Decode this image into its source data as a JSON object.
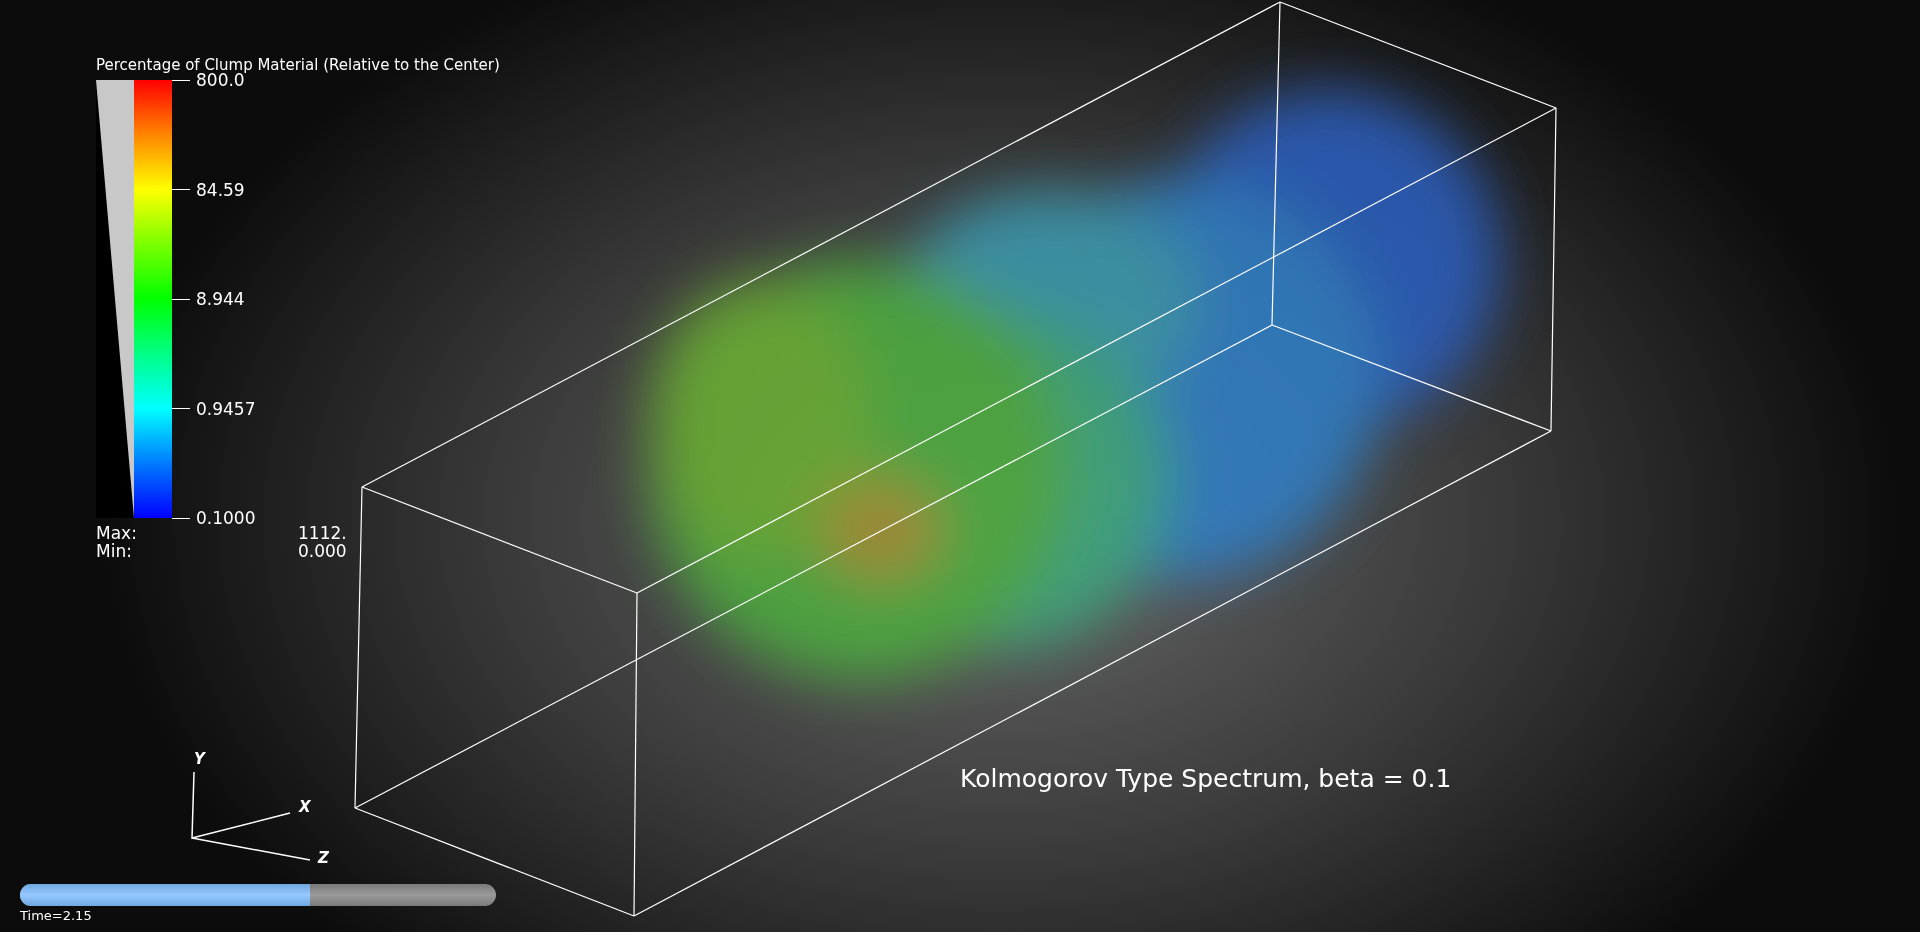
{
  "legend": {
    "title": "Percentage of Clump Material (Relative to the Center)",
    "ticks": [
      "800.0",
      "84.59",
      "8.944",
      "0.9457",
      "0.1000"
    ],
    "max_label": "Max:",
    "max_value": "1112.",
    "min_label": "Min:",
    "min_value": "0.000"
  },
  "annotation": "Kolmogorov Type Spectrum, beta = 0.1",
  "axes": {
    "y": "Y",
    "x": "X",
    "z": "Z"
  },
  "time_slider": {
    "level": 0.61,
    "label": "Time=2.15"
  }
}
